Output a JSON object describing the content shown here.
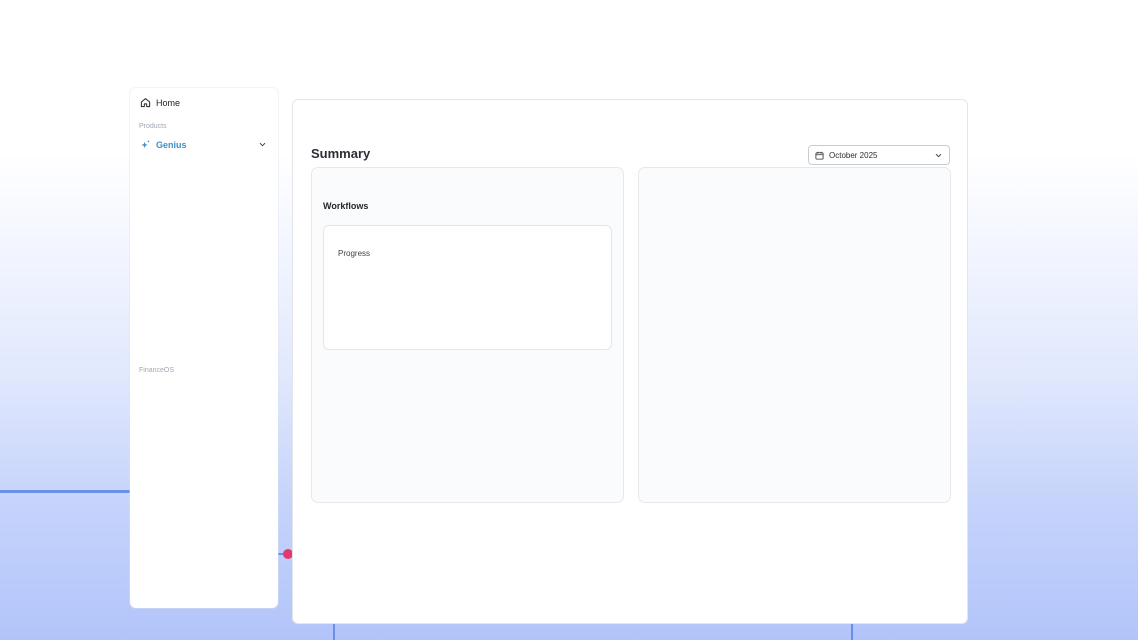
{
  "sidebar": {
    "home_label": "Home",
    "products_label": "Products",
    "genius_label": "Genius",
    "financeos_label": "FinanceOS"
  },
  "main": {
    "title": "Summary",
    "date_picker": {
      "value": "October 2025"
    },
    "workflows_card": {
      "title": "Workflows",
      "progress_label": "Progress"
    }
  },
  "colors": {
    "accent": "#3f8fc4",
    "connector_dot": "#e23a6d",
    "bg_line": "#6b8fe6"
  },
  "icons": {
    "home": "home-icon",
    "genius": "sparkle-icon",
    "expand": "chevron-down-icon",
    "calendar": "calendar-icon",
    "dropdown": "chevron-down-icon"
  }
}
